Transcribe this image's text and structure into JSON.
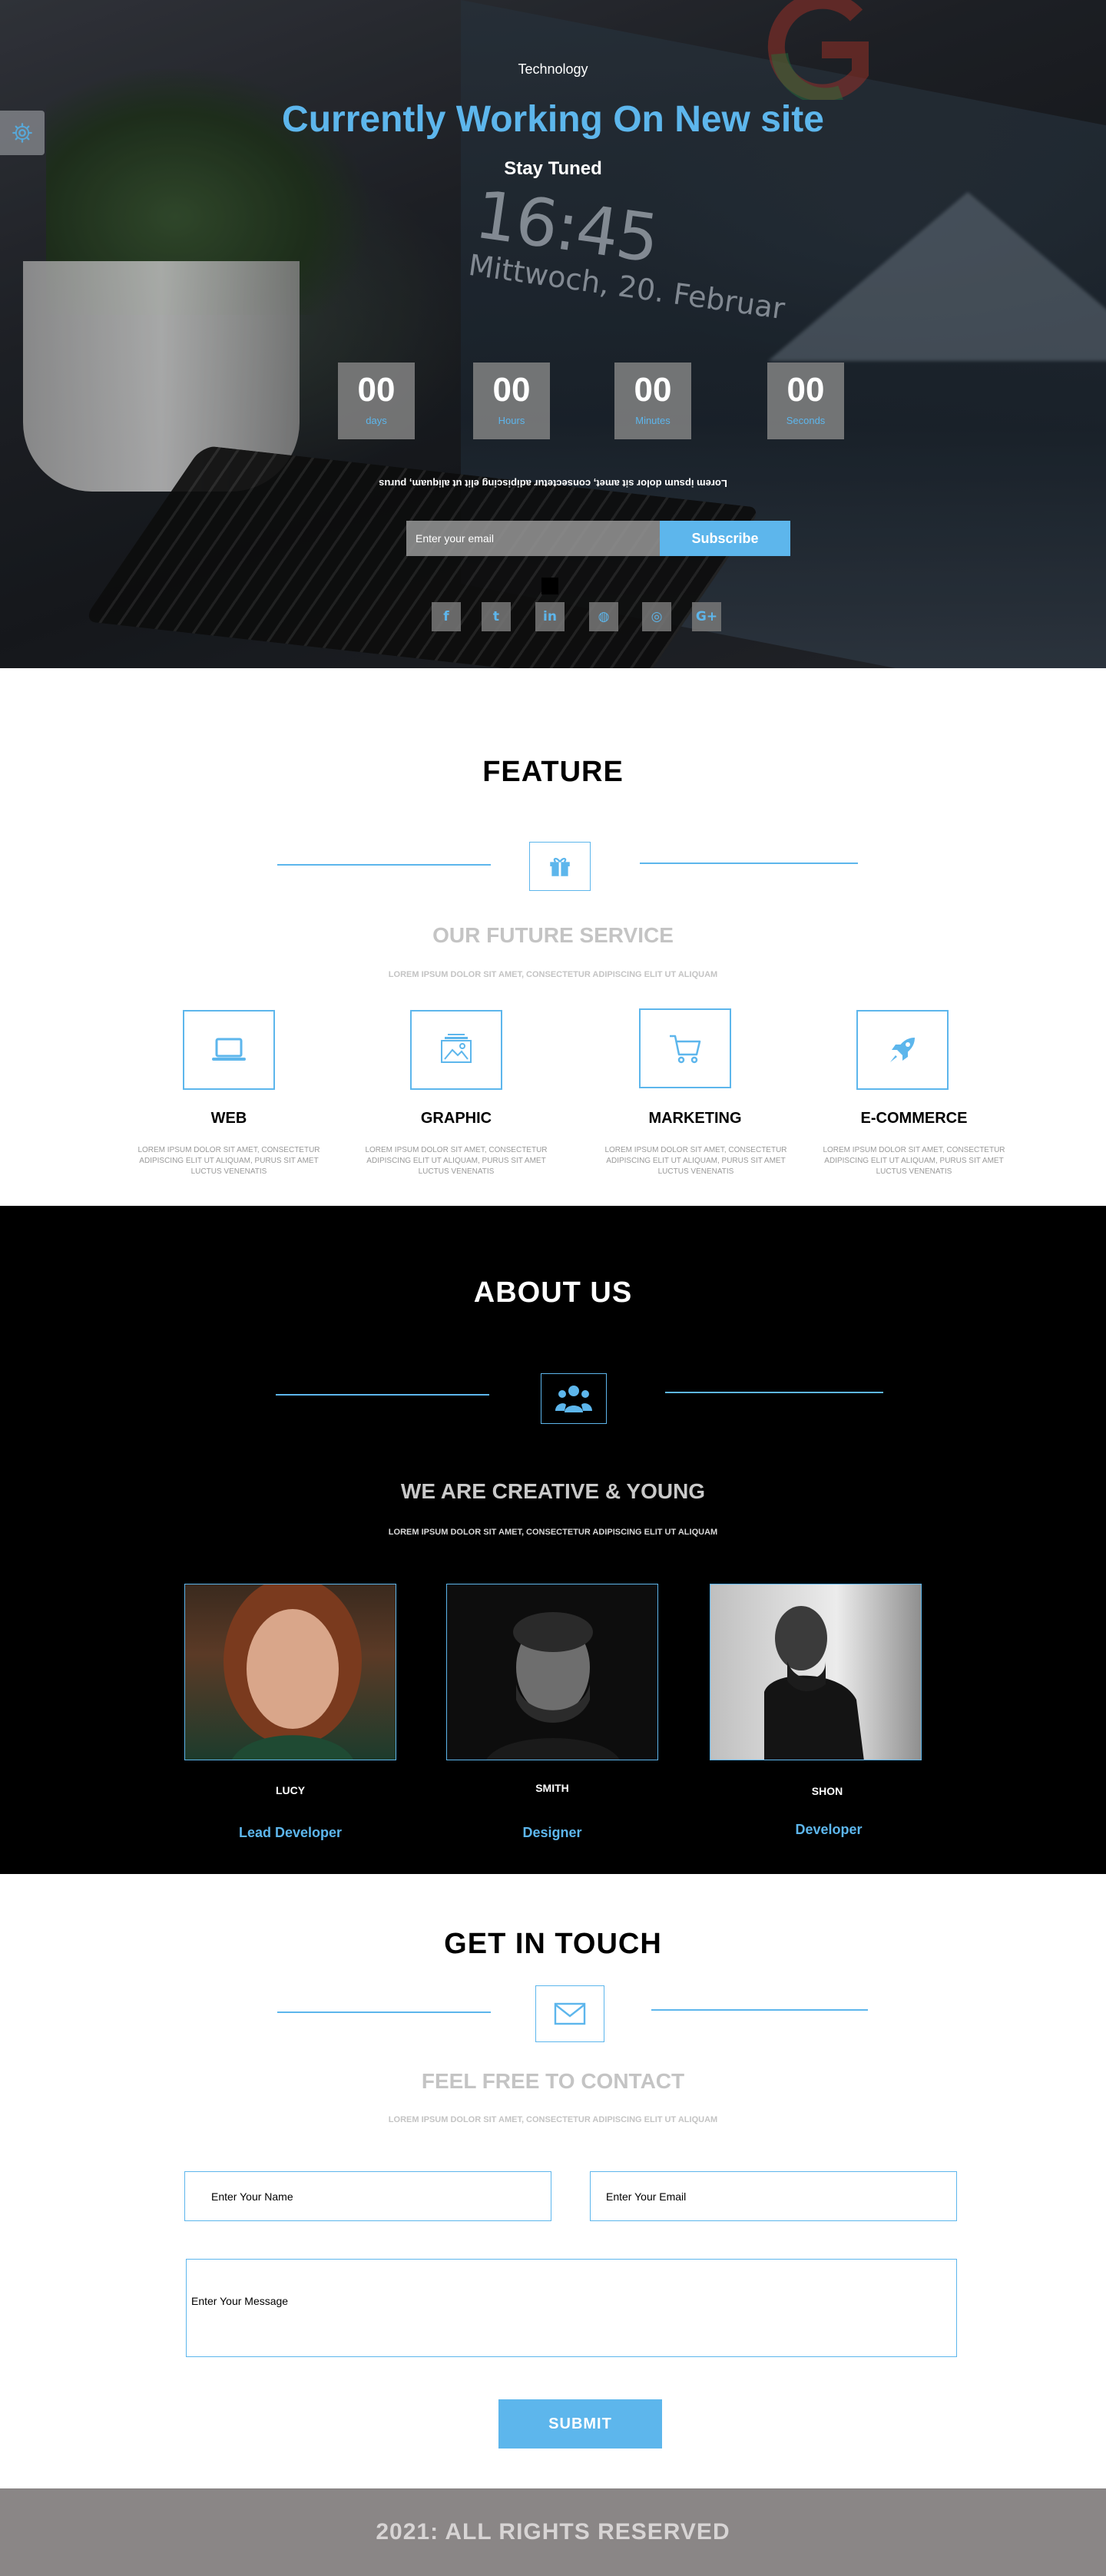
{
  "hero": {
    "eyebrow": "Technology",
    "headline": "Currently Working On New site",
    "subline": "Stay Tuned",
    "clock_time": "16:45",
    "clock_date": "Mittwoch, 20. Februar",
    "countdown": [
      {
        "value": "00",
        "unit": "days"
      },
      {
        "value": "00",
        "unit": "Hours"
      },
      {
        "value": "00",
        "unit": "Minutes"
      },
      {
        "value": "00",
        "unit": "Seconds"
      }
    ],
    "mirrored_text": "Lorem ipsum dolor sit amet, consectetur adipiscing elit ut aliquam, purus",
    "email_placeholder": "Enter your email",
    "subscribe_label": "Subscribe",
    "social": [
      {
        "icon": "facebook-icon",
        "glyph": "f"
      },
      {
        "icon": "twitter-icon",
        "glyph": "t"
      },
      {
        "icon": "linkedin-icon",
        "glyph": "in"
      },
      {
        "icon": "dribbble-icon",
        "glyph": "◍"
      },
      {
        "icon": "globe-icon",
        "glyph": "◎"
      },
      {
        "icon": "google-plus-icon",
        "glyph": "G+"
      }
    ]
  },
  "feature": {
    "title": "FEATURE",
    "icon": "gift-icon",
    "subtitle": "OUR FUTURE SERVICE",
    "tagline": "LOREM IPSUM DOLOR SIT AMET, CONSECTETUR ADIPISCING ELIT UT ALIQUAM",
    "services": [
      {
        "icon": "laptop-icon",
        "name": "WEB",
        "desc": "LOREM IPSUM DOLOR SIT AMET, CONSECTETUR ADIPISCING ELIT UT ALIQUAM, PURUS SIT AMET LUCTUS VENENATIS"
      },
      {
        "icon": "image-gallery-icon",
        "name": "GRAPHIC",
        "desc": "LOREM IPSUM DOLOR SIT AMET, CONSECTETUR ADIPISCING ELIT UT ALIQUAM, PURUS SIT AMET LUCTUS VENENATIS"
      },
      {
        "icon": "shopping-cart-icon",
        "name": "MARKETING",
        "desc": "LOREM IPSUM DOLOR SIT AMET, CONSECTETUR ADIPISCING ELIT UT ALIQUAM, PURUS SIT AMET LUCTUS VENENATIS"
      },
      {
        "icon": "rocket-icon",
        "name": "E-COMMERCE",
        "desc": "LOREM IPSUM DOLOR SIT AMET, CONSECTETUR ADIPISCING ELIT UT ALIQUAM, PURUS SIT AMET LUCTUS VENENATIS"
      }
    ]
  },
  "about": {
    "title": "ABOUT US",
    "icon": "users-icon",
    "subtitle": "WE ARE CREATIVE & YOUNG",
    "tagline": "LOREM IPSUM DOLOR SIT AMET, CONSECTETUR ADIPISCING ELIT UT ALIQUAM",
    "members": [
      {
        "name": "LUCY",
        "role": "Lead Developer"
      },
      {
        "name": "SMITH",
        "role": "Designer"
      },
      {
        "name": "SHON",
        "role": "Developer"
      }
    ]
  },
  "contact": {
    "title": "GET IN TOUCH",
    "icon": "envelope-icon",
    "subtitle": "FEEL FREE TO CONTACT",
    "tagline": "LOREM IPSUM DOLOR SIT AMET, CONSECTETUR ADIPISCING ELIT UT ALIQUAM",
    "name_placeholder": "Enter Your Name",
    "email_placeholder": "Enter Your Email",
    "message_placeholder": "Enter Your Message",
    "submit_label": "SUBMIT"
  },
  "footer": {
    "text": "2021: ALL RIGHTS RESERVED"
  },
  "colors": {
    "accent": "#5db6ec",
    "muted_heading": "#c4c4c4",
    "footer_bg": "#8a8686"
  }
}
